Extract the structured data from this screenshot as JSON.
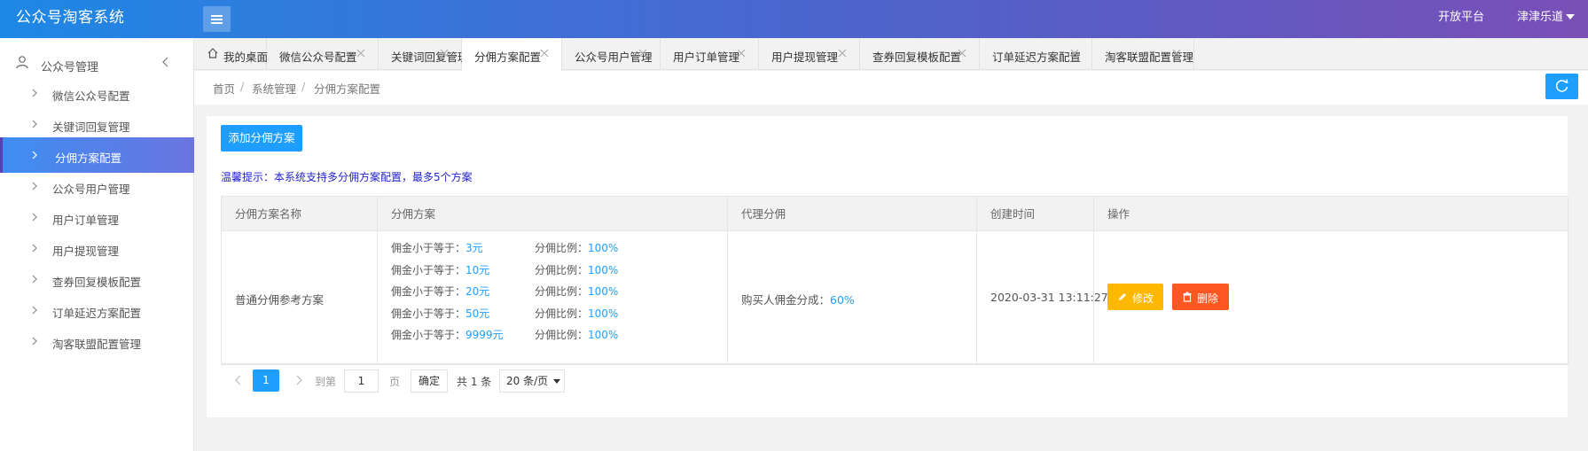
{
  "header": {
    "app_title": "公众号淘客系统",
    "open_platform": "开放平台",
    "user_name": "津津乐道"
  },
  "sidebar": {
    "group_label": "公众号管理",
    "items": [
      {
        "label": "微信公众号配置"
      },
      {
        "label": "关键词回复管理"
      },
      {
        "label": "分佣方案配置",
        "active": true
      },
      {
        "label": "公众号用户管理"
      },
      {
        "label": "用户订单管理"
      },
      {
        "label": "用户提现管理"
      },
      {
        "label": "查券回复模板配置"
      },
      {
        "label": "订单延迟方案配置"
      },
      {
        "label": "淘客联盟配置管理"
      }
    ]
  },
  "tabs": [
    {
      "label": "我的桌面",
      "home": true
    },
    {
      "label": "微信公众号配置"
    },
    {
      "label": "关键词回复管理"
    },
    {
      "label": "分佣方案配置",
      "active": true
    },
    {
      "label": "公众号用户管理"
    },
    {
      "label": "用户订单管理"
    },
    {
      "label": "用户提现管理"
    },
    {
      "label": "查券回复模板配置"
    },
    {
      "label": "订单延迟方案配置"
    },
    {
      "label": "淘客联盟配置管理"
    }
  ],
  "breadcrumb": [
    "首页",
    "系统管理",
    "分佣方案配置"
  ],
  "main": {
    "add_button": "添加分佣方案",
    "tip": "温馨提示：本系统支持多分佣方案配置，最多5个方案",
    "table": {
      "headers": [
        "分佣方案名称",
        "分佣方案",
        "代理分佣",
        "创建时间",
        "操作"
      ],
      "rows": [
        {
          "name": "普通分佣参考方案",
          "tiers": [
            {
              "label1": "佣金小于等于：",
              "threshold": "3元",
              "label2": "分佣比例：",
              "ratio": "100%"
            },
            {
              "label1": "佣金小于等于：",
              "threshold": "10元",
              "label2": "分佣比例：",
              "ratio": "100%"
            },
            {
              "label1": "佣金小于等于：",
              "threshold": "20元",
              "label2": "分佣比例：",
              "ratio": "100%"
            },
            {
              "label1": "佣金小于等于：",
              "threshold": "50元",
              "label2": "分佣比例：",
              "ratio": "100%"
            },
            {
              "label1": "佣金小于等于：",
              "threshold": "9999元",
              "label2": "分佣比例：",
              "ratio": "100%"
            }
          ],
          "agent_label": "购买人佣金分成：",
          "agent_value": "60%",
          "created_at": "2020-03-31 13:11:27",
          "edit_label": "修改",
          "delete_label": "删除"
        }
      ]
    },
    "pager": {
      "current": "1",
      "goto_label": "到第",
      "goto_value": "1",
      "page_label": "页",
      "confirm": "确定",
      "total": "共 1 条",
      "page_size": "20 条/页"
    }
  },
  "colors": {
    "primary": "#1e9fff",
    "warn": "#ffb800",
    "danger": "#ff5722",
    "tip": "#1f1fd0"
  }
}
